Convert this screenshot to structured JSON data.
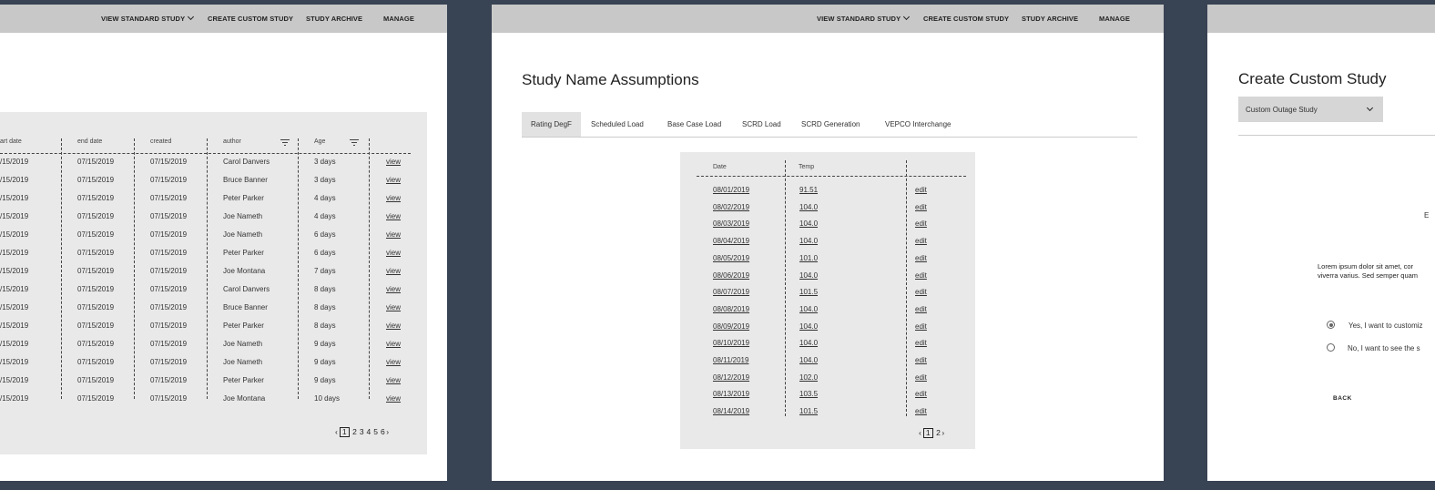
{
  "nav": {
    "view_standard": "VIEW STANDARD STUDY",
    "create_custom": "CREATE CUSTOM STUDY",
    "archive": "STUDY ARCHIVE",
    "manage": "MANAGE"
  },
  "panel1": {
    "columns": {
      "start_date": "art date",
      "end_date": "end date",
      "created": "created",
      "author": "author",
      "age": "Age"
    },
    "rows": [
      {
        "start": "/15/2019",
        "end": "07/15/2019",
        "created": "07/15/2019",
        "author": "Carol Danvers",
        "age": "3 days",
        "action": "view"
      },
      {
        "start": "/15/2019",
        "end": "07/15/2019",
        "created": "07/15/2019",
        "author": "Bruce Banner",
        "age": "3 days",
        "action": "view"
      },
      {
        "start": "/15/2019",
        "end": "07/15/2019",
        "created": "07/15/2019",
        "author": "Peter Parker",
        "age": "4 days",
        "action": "view"
      },
      {
        "start": "/15/2019",
        "end": "07/15/2019",
        "created": "07/15/2019",
        "author": "Joe Nameth",
        "age": "4 days",
        "action": "view"
      },
      {
        "start": "/15/2019",
        "end": "07/15/2019",
        "created": "07/15/2019",
        "author": "Joe Nameth",
        "age": "6 days",
        "action": "view"
      },
      {
        "start": "/15/2019",
        "end": "07/15/2019",
        "created": "07/15/2019",
        "author": "Peter Parker",
        "age": "6 days",
        "action": "view"
      },
      {
        "start": "/15/2019",
        "end": "07/15/2019",
        "created": "07/15/2019",
        "author": "Joe Montana",
        "age": "7 days",
        "action": "view"
      },
      {
        "start": "/15/2019",
        "end": "07/15/2019",
        "created": "07/15/2019",
        "author": "Carol Danvers",
        "age": "8 days",
        "action": "view"
      },
      {
        "start": "/15/2019",
        "end": "07/15/2019",
        "created": "07/15/2019",
        "author": "Bruce Banner",
        "age": "8 days",
        "action": "view"
      },
      {
        "start": "/15/2019",
        "end": "07/15/2019",
        "created": "07/15/2019",
        "author": "Peter Parker",
        "age": "8 days",
        "action": "view"
      },
      {
        "start": "/15/2019",
        "end": "07/15/2019",
        "created": "07/15/2019",
        "author": "Joe Nameth",
        "age": "9 days",
        "action": "view"
      },
      {
        "start": "/15/2019",
        "end": "07/15/2019",
        "created": "07/15/2019",
        "author": "Joe Nameth",
        "age": "9 days",
        "action": "view"
      },
      {
        "start": "/15/2019",
        "end": "07/15/2019",
        "created": "07/15/2019",
        "author": "Peter Parker",
        "age": "9 days",
        "action": "view"
      },
      {
        "start": "/15/2019",
        "end": "07/15/2019",
        "created": "07/15/2019",
        "author": "Joe Montana",
        "age": "10 days",
        "action": "view"
      }
    ],
    "pager": {
      "prev": "‹",
      "current": "1",
      "pages": [
        "2",
        "3",
        "4",
        "5",
        "6"
      ],
      "next": "›"
    }
  },
  "panel2": {
    "title": "Study Name Assumptions",
    "tabs": [
      "Rating DegF",
      "Scheduled Load",
      "Base Case Load",
      "SCRD Load",
      "SCRD Generation",
      "VEPCO Interchange"
    ],
    "active_tab": "Rating DegF",
    "columns": {
      "date": "Date",
      "temp": "Temp"
    },
    "rows": [
      {
        "date": "08/01/2019",
        "temp": "91.51",
        "action": "edit"
      },
      {
        "date": "08/02/2019",
        "temp": "104.0",
        "action": "edit"
      },
      {
        "date": "08/03/2019",
        "temp": "104.0",
        "action": "edit"
      },
      {
        "date": "08/04/2019",
        "temp": "104.0",
        "action": "edit"
      },
      {
        "date": "08/05/2019",
        "temp": "101.0",
        "action": "edit"
      },
      {
        "date": "08/06/2019",
        "temp": "104.0",
        "action": "edit"
      },
      {
        "date": "08/07/2019",
        "temp": "101.5",
        "action": "edit"
      },
      {
        "date": "08/08/2019",
        "temp": "104.0",
        "action": "edit"
      },
      {
        "date": "08/09/2019",
        "temp": "104.0",
        "action": "edit"
      },
      {
        "date": "08/10/2019",
        "temp": "104.0",
        "action": "edit"
      },
      {
        "date": "08/11/2019",
        "temp": "104.0",
        "action": "edit"
      },
      {
        "date": "08/12/2019",
        "temp": "102.0",
        "action": "edit"
      },
      {
        "date": "08/13/2019",
        "temp": "103.5",
        "action": "edit"
      },
      {
        "date": "08/14/2019",
        "temp": "101.5",
        "action": "edit"
      }
    ],
    "pager": {
      "prev": "‹",
      "current": "1",
      "pages": [
        "2"
      ],
      "next": "›"
    }
  },
  "panel3": {
    "title": "Create Custom Study",
    "select_value": "Custom Outage Study",
    "partial_letter": "E",
    "lorem_line1": "Lorem ipsum dolor sit amet, cor",
    "lorem_line2": "viverra varius. Sed semper quam",
    "radio_yes": "Yes, I want to customiz",
    "radio_no": "No, I want to see the s",
    "back": "BACK"
  },
  "colors": {
    "background": "#384353",
    "nav": "#c8c8c8",
    "table_bg": "#e9e9e9"
  },
  "icons": [
    "chevron-down-icon",
    "filter-icon",
    "chevron-left-icon",
    "chevron-right-icon",
    "radio-selected-icon",
    "radio-empty-icon"
  ]
}
